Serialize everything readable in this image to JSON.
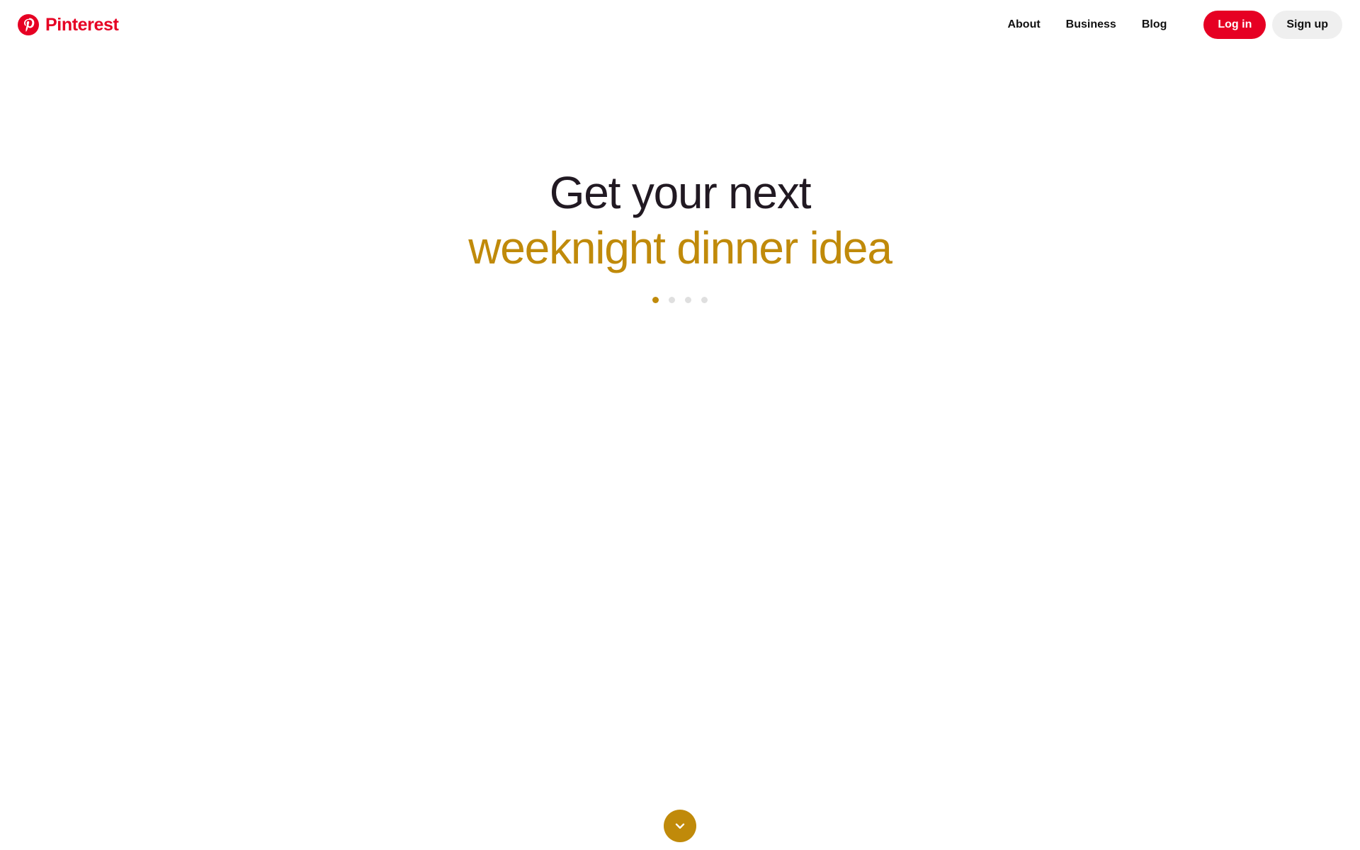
{
  "page": {
    "title": "Pinterest",
    "background_color": "#ffffff"
  },
  "colors": {
    "brand_red": "#e60023",
    "accent_gold": "#c08a0a",
    "headline_dark": "#211922",
    "dot_inactive": "#dfdfdf",
    "signup_bg": "#efefef"
  },
  "header": {
    "logo": {
      "icon": "pinterest-logo-icon",
      "wordmark": "Pinterest"
    },
    "nav_links": [
      {
        "label": "About"
      },
      {
        "label": "Business"
      },
      {
        "label": "Blog"
      }
    ],
    "login_label": "Log in",
    "signup_label": "Sign up"
  },
  "hero": {
    "headline_line1": "Get your next",
    "headline_line2": "weeknight dinner idea",
    "carousel": {
      "active_index": 0,
      "dots": [
        {
          "active": true
        },
        {
          "active": false
        },
        {
          "active": false
        },
        {
          "active": false
        }
      ]
    }
  },
  "scroll_button": {
    "icon": "chevron-down-icon"
  }
}
